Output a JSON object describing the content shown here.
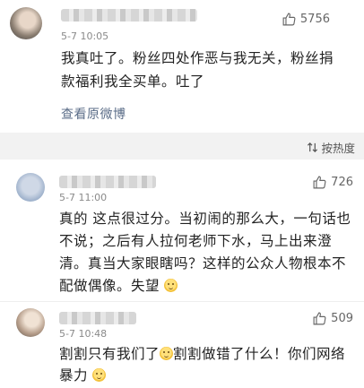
{
  "post": {
    "time": "5-7 10:05",
    "likes": "5756",
    "text_line1": "我真吐了。粉丝四处作恶与我无关，粉丝捐",
    "text_line2": "款福利我全买单。吐了",
    "view_original": "查看原微博"
  },
  "sort": {
    "label": "按热度",
    "icon": "sort-icon"
  },
  "comments": [
    {
      "time": "5-7 11:00",
      "likes": "726",
      "lines": [
        "真的 这点很过分。当初闹的那么大，一句话也",
        "不说；之后有人拉何老师下水，马上出来澄",
        "清。真当大家眼瞎吗？这样的公众人物根本不",
        "配做偶像。失望"
      ]
    },
    {
      "time": "5-7 10:48",
      "likes": "509",
      "line1a": "割割只有我们了",
      "line1b": "割割做错了什么！你们网络",
      "line2": "暴力"
    }
  ],
  "colors": {
    "link": "#5b6d88",
    "band": "#f2f2f2",
    "text": "#222222",
    "meta": "#8a8a8a"
  }
}
